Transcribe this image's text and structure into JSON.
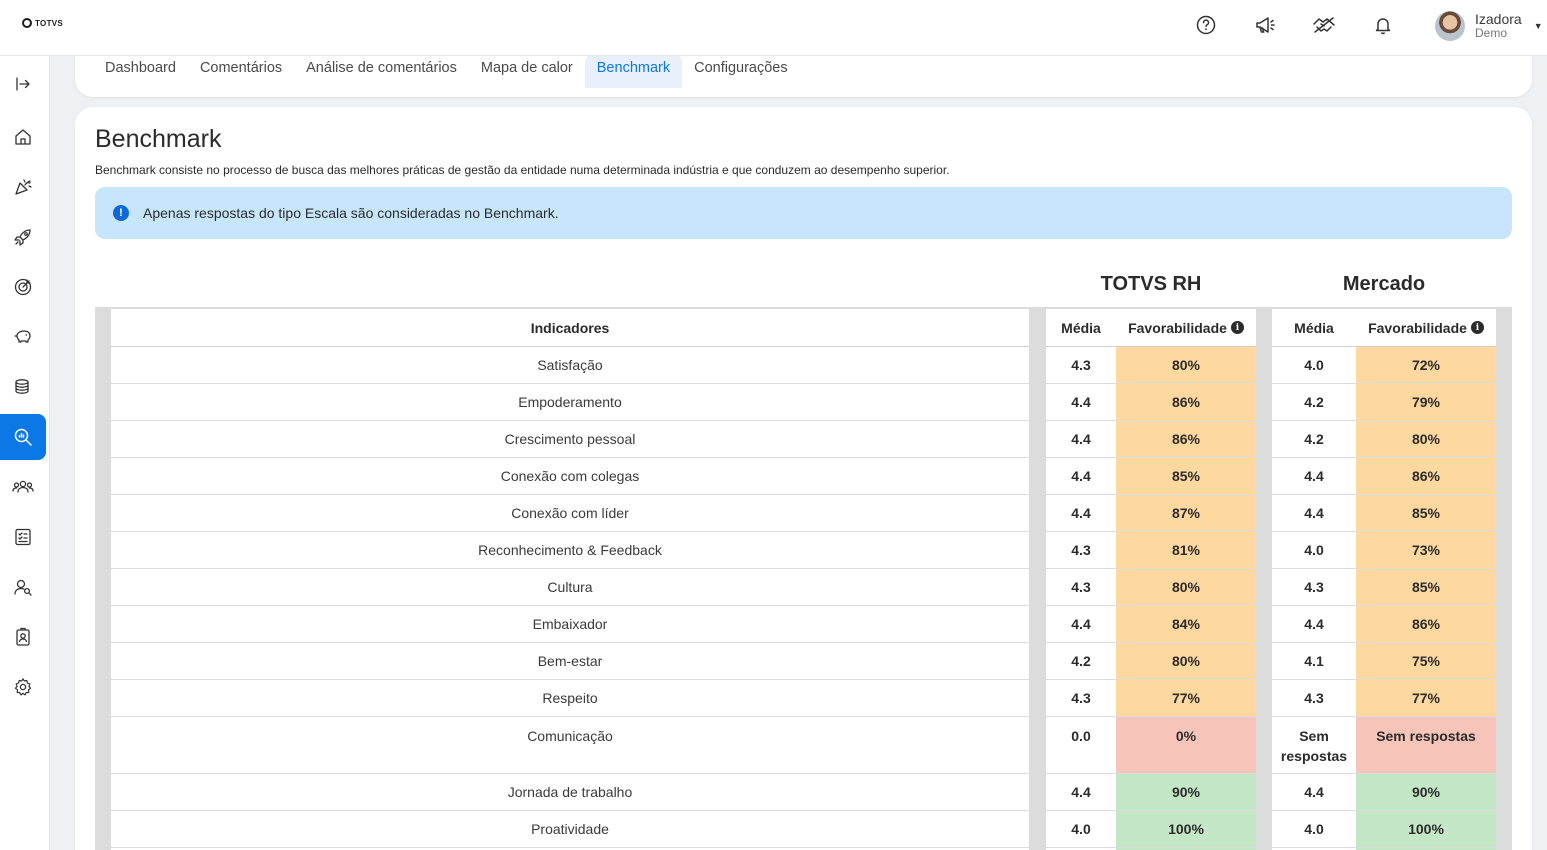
{
  "header": {
    "logo_text": "TOTVS",
    "icons": [
      "help-icon",
      "megaphone-icon",
      "handshake-icon",
      "bell-icon"
    ],
    "user": {
      "name": "Izadora",
      "role": "Demo"
    }
  },
  "sidebar": {
    "items": [
      "expand-icon",
      "home-icon",
      "celebration-icon",
      "rocket-icon",
      "target-icon",
      "piggy-bank-icon",
      "coins-icon",
      "search-analytics-icon",
      "people-icon",
      "checklist-icon",
      "user-search-icon",
      "badge-icon",
      "gear-icon"
    ],
    "active_index": 7
  },
  "tabs": [
    {
      "label": "Dashboard"
    },
    {
      "label": "Comentários"
    },
    {
      "label": "Análise de comentários"
    },
    {
      "label": "Mapa de calor"
    },
    {
      "label": "Benchmark",
      "active": true
    },
    {
      "label": "Configurações"
    }
  ],
  "page": {
    "title": "Benchmark",
    "description": "Benchmark consiste no processo de busca das melhores práticas de gestão da entidade numa determinada indústria e que conduzem ao desempenho superior.",
    "info": "Apenas respostas do tipo Escala são consideradas no Benchmark."
  },
  "table": {
    "group_totvs": "TOTVS RH",
    "group_mercado": "Mercado",
    "col_indicadores": "Indicadores",
    "col_media": "Média",
    "col_favorabilidade": "Favorabilidade",
    "rows": [
      {
        "indicador": "Satisfação",
        "t_media": "4.3",
        "t_fav": "80%",
        "t_color": "orange",
        "m_media": "4.0",
        "m_fav": "72%",
        "m_color": "orange"
      },
      {
        "indicador": "Empoderamento",
        "t_media": "4.4",
        "t_fav": "86%",
        "t_color": "orange",
        "m_media": "4.2",
        "m_fav": "79%",
        "m_color": "orange"
      },
      {
        "indicador": "Crescimento pessoal",
        "t_media": "4.4",
        "t_fav": "86%",
        "t_color": "orange",
        "m_media": "4.2",
        "m_fav": "80%",
        "m_color": "orange"
      },
      {
        "indicador": "Conexão com colegas",
        "t_media": "4.4",
        "t_fav": "85%",
        "t_color": "orange",
        "m_media": "4.4",
        "m_fav": "86%",
        "m_color": "orange"
      },
      {
        "indicador": "Conexão com líder",
        "t_media": "4.4",
        "t_fav": "87%",
        "t_color": "orange",
        "m_media": "4.4",
        "m_fav": "85%",
        "m_color": "orange"
      },
      {
        "indicador": "Reconhecimento & Feedback",
        "t_media": "4.3",
        "t_fav": "81%",
        "t_color": "orange",
        "m_media": "4.0",
        "m_fav": "73%",
        "m_color": "orange"
      },
      {
        "indicador": "Cultura",
        "t_media": "4.3",
        "t_fav": "80%",
        "t_color": "orange",
        "m_media": "4.3",
        "m_fav": "85%",
        "m_color": "orange"
      },
      {
        "indicador": "Embaixador",
        "t_media": "4.4",
        "t_fav": "84%",
        "t_color": "orange",
        "m_media": "4.4",
        "m_fav": "86%",
        "m_color": "orange"
      },
      {
        "indicador": "Bem-estar",
        "t_media": "4.2",
        "t_fav": "80%",
        "t_color": "orange",
        "m_media": "4.1",
        "m_fav": "75%",
        "m_color": "orange"
      },
      {
        "indicador": "Respeito",
        "t_media": "4.3",
        "t_fav": "77%",
        "t_color": "orange",
        "m_media": "4.3",
        "m_fav": "77%",
        "m_color": "orange"
      },
      {
        "indicador": "Comunicação",
        "t_media": "0.0",
        "t_fav": "0%",
        "t_color": "red",
        "m_media": "Sem respostas",
        "m_fav": "Sem respostas",
        "m_color": "red",
        "tall": true
      },
      {
        "indicador": "Jornada de trabalho",
        "t_media": "4.4",
        "t_fav": "90%",
        "t_color": "green",
        "m_media": "4.4",
        "m_fav": "90%",
        "m_color": "green"
      },
      {
        "indicador": "Proatividade",
        "t_media": "4.0",
        "t_fav": "100%",
        "t_color": "green",
        "m_media": "4.0",
        "m_fav": "100%",
        "m_color": "green"
      },
      {
        "indicador": "",
        "t_media": "",
        "t_fav": "",
        "t_color": "green",
        "m_media": "",
        "m_fav": "",
        "m_color": "green"
      }
    ]
  }
}
